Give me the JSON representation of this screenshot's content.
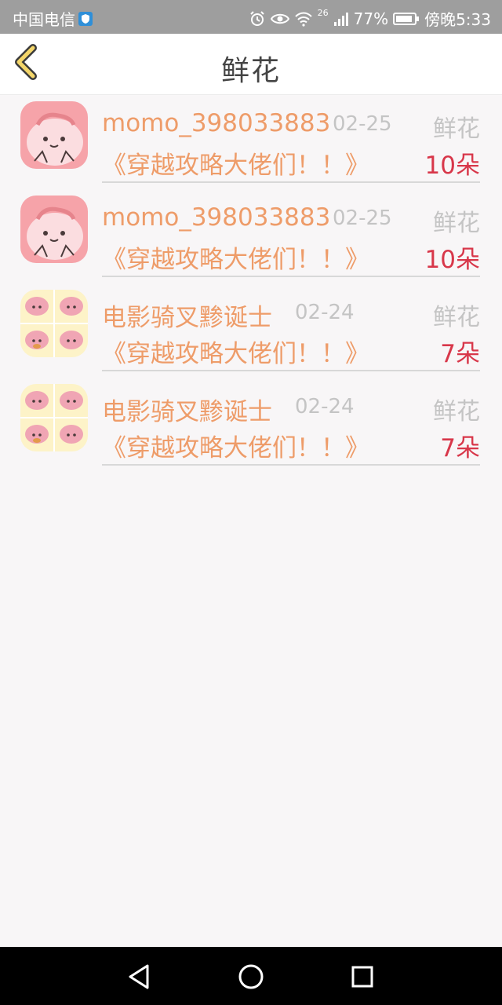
{
  "status": {
    "carrier": "中国电信",
    "network": "26",
    "battery": "77%",
    "time": "傍晚5:33"
  },
  "header": {
    "title": "鲜花"
  },
  "icons": {
    "back": "chevron-left-icon",
    "nav_back": "triangle-back-icon",
    "nav_home": "circle-home-icon",
    "nav_recent": "square-recent-icon"
  },
  "colors": {
    "accent": "#ee9c69",
    "count": "#d8374a",
    "muted": "#c4c4c4",
    "background": "#f8f6f7"
  },
  "records": [
    {
      "name": "momo_398033883",
      "date": "02-25",
      "type": "鲜花",
      "book": "《穿越攻略大佬们！！》",
      "count": "10朵",
      "avatar": "pink-blob"
    },
    {
      "name": "momo_398033883",
      "date": "02-25",
      "type": "鲜花",
      "book": "《穿越攻略大佬们！！》",
      "count": "10朵",
      "avatar": "pink-blob"
    },
    {
      "name": "电影骑叉黪诞士",
      "date": "02-24",
      "type": "鲜花",
      "book": "《穿越攻略大佬们！！》",
      "count": "7朵",
      "avatar": "quad-blob"
    },
    {
      "name": "电影骑叉黪诞士",
      "date": "02-24",
      "type": "鲜花",
      "book": "《穿越攻略大佬们！！》",
      "count": "7朵",
      "avatar": "quad-blob"
    }
  ]
}
